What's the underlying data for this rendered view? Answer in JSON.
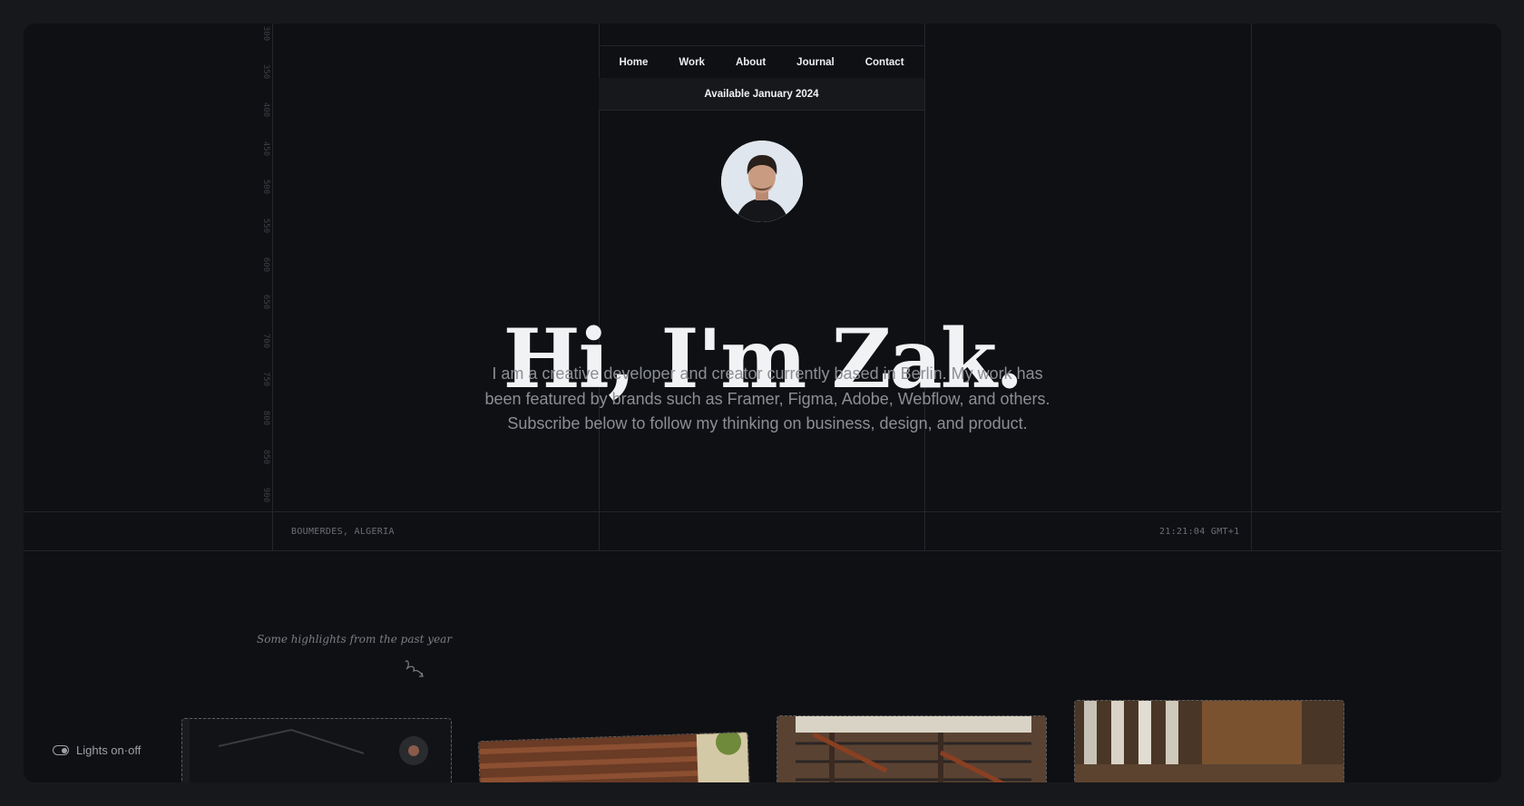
{
  "nav": {
    "items": [
      "Home",
      "Work",
      "About",
      "Journal",
      "Contact"
    ]
  },
  "availability": "Available January 2024",
  "hero": {
    "title": "Hi, I'm Zak.",
    "intro_lines": [
      "I am a creative developer and creator currently based in Berlin. My work has",
      "been featured by brands such as Framer, Figma, Adobe, Webflow, and others.",
      "Subscribe below to follow my thinking on business, design, and product."
    ]
  },
  "ruler": {
    "ticks": [
      "300",
      "350",
      "400",
      "450",
      "500",
      "550",
      "600",
      "650",
      "700",
      "750",
      "800",
      "850",
      "900"
    ]
  },
  "meta": {
    "location": "BOUMERDES, ALGERIA",
    "time": "21:21:04 GMT+1"
  },
  "highlights": {
    "label": "Some highlights from the past year"
  },
  "lights_toggle": {
    "label": "Lights on·off",
    "icon": "toggle-icon"
  },
  "colors": {
    "page_bg": "#17181b",
    "frame_bg": "#0f1013",
    "text_primary": "#f1f2f4",
    "text_muted": "#8b8e95"
  }
}
